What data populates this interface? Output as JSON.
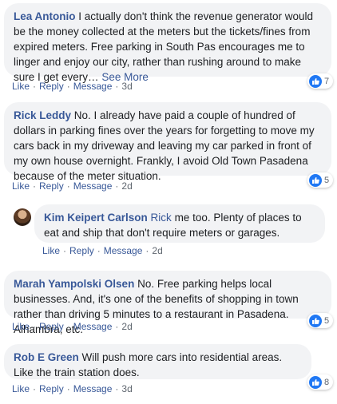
{
  "comments": [
    {
      "author": "Lea Antonio",
      "text": "I actually don't think the revenue generator would be the money collected at the meters but the tickets/fines from expired meters. Free parking in South Pas encourages me to linger and enjoy our city, rather than rushing around to make sure I get every…",
      "see_more": "See More",
      "like": "Like",
      "reply": "Reply",
      "message": "Message",
      "time": "3d",
      "reactions": "7"
    },
    {
      "author": "Rick Leddy",
      "text": "No. I already have paid a couple of hundred of dollars in parking fines over the years for forgetting to move my cars back in my driveway and leaving my car parked in front of my own house overnight. Frankly, I avoid Old Town Pasadena because of the meter situation.",
      "like": "Like",
      "reply": "Reply",
      "message": "Message",
      "time": "2d",
      "reactions": "5"
    },
    {
      "author": "Kim Keipert Carlson",
      "mention": "Rick",
      "text": "me too. Plenty of places to eat and ship that don't require meters or garages.",
      "like": "Like",
      "reply": "Reply",
      "message": "Message",
      "time": "2d"
    },
    {
      "author": "Marah Yampolski Olsen",
      "text": "No. Free parking helps local businesses. And, it's one of the benefits of shopping in town rather than driving 5 minutes to a restaurant in Pasadena. Alhambra, etc.",
      "like": "Like",
      "reply": "Reply",
      "message": "Message",
      "time": "2d",
      "reactions": "5"
    },
    {
      "author": "Rob E Green",
      "text": "Will push more cars into residential areas. Like the train station does.",
      "like": "Like",
      "reply": "Reply",
      "message": "Message",
      "time": "3d",
      "reactions": "8"
    }
  ],
  "separator": "·",
  "colors": {
    "link": "#385898",
    "bubble": "#f2f3f5",
    "like_badge": "#2078f4",
    "meta": "#606770"
  },
  "icons": {
    "reaction": "thumbs-up-icon",
    "avatar": "avatar"
  }
}
